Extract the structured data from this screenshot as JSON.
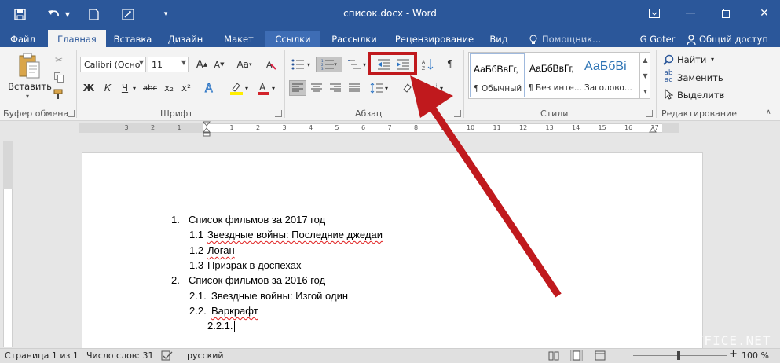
{
  "window": {
    "title": "список.docx - Word",
    "minimize_icon": "minimize-icon",
    "restore_icon": "restore-icon"
  },
  "qat": [
    "save-icon",
    "undo-icon",
    "new-doc-icon",
    "touch-mode-icon",
    "customize-qat-icon"
  ],
  "tabs": [
    {
      "label": "Файл"
    },
    {
      "label": "Главная"
    },
    {
      "label": "Вставка"
    },
    {
      "label": "Дизайн"
    },
    {
      "label": "Макет"
    },
    {
      "label": "Ссылки"
    },
    {
      "label": "Рассылки"
    },
    {
      "label": "Рецензирование"
    },
    {
      "label": "Вид"
    },
    {
      "label": "Помощник..."
    }
  ],
  "active_tab": "Главная",
  "user": {
    "name": "G Goter",
    "share": "Общий доступ"
  },
  "ribbon": {
    "clipboard": {
      "paste": "Вставить",
      "label": "Буфер обмена"
    },
    "font": {
      "font_name": "Calibri (Осно",
      "font_size": "11",
      "grow": "A",
      "shrink": "A",
      "case": "Aa",
      "bold": "Ж",
      "italic": "К",
      "underline": "Ч",
      "strike": "abc",
      "subscript": "x₂",
      "superscript": "x²",
      "label": "Шрифт"
    },
    "paragraph": {
      "label": "Абзац",
      "pilcrow": "¶"
    },
    "styles": {
      "items": [
        {
          "preview": "АаБбВвГг,",
          "name": "¶ Обычный"
        },
        {
          "preview": "АаБбВвГг,",
          "name": "¶ Без инте..."
        },
        {
          "preview": "АаБбВі",
          "name": "Заголово..."
        }
      ],
      "label": "Стили"
    },
    "editing": {
      "find": "Найти",
      "replace": "Заменить",
      "select": "Выделить",
      "label": "Редактирование"
    }
  },
  "ruler_numbers": [
    "3",
    "2",
    "1",
    "1",
    "2",
    "3",
    "4",
    "5",
    "6",
    "7",
    "8",
    "9",
    "10",
    "11",
    "12",
    "13",
    "14",
    "15",
    "16",
    "17"
  ],
  "document": {
    "lines": [
      {
        "num": "1.",
        "text": "Список фильмов за 2017 год",
        "squiggle": false
      },
      {
        "num": "1.1",
        "text": "Звездные войны: Последние джедаи",
        "squiggle": true
      },
      {
        "num": "1.2",
        "text": "Логан",
        "squiggle": true
      },
      {
        "num": "1.3",
        "text": "Призрак в доспехах",
        "squiggle": false
      },
      {
        "num": "2.",
        "text": "Список фильмов за 2016 год",
        "squiggle": false
      },
      {
        "num": "2.1.",
        "text": "Звездные войны: Изгой один",
        "squiggle": false
      },
      {
        "num": "2.2.",
        "text": "Варкрафт",
        "squiggle": true
      },
      {
        "num": "2.2.1.",
        "text": "",
        "squiggle": false
      }
    ]
  },
  "status": {
    "page": "Страница 1 из 1",
    "words": "Число слов: 31",
    "language": "русский",
    "zoom": "100 %",
    "zoom_minus": "–",
    "zoom_plus": "+"
  },
  "watermark": "FREE-OFFICE.NET",
  "colors": {
    "accent": "#2b579a",
    "annotation_red": "#c0191d",
    "font_color": "#d2232a",
    "highlight": "#ffee00"
  }
}
